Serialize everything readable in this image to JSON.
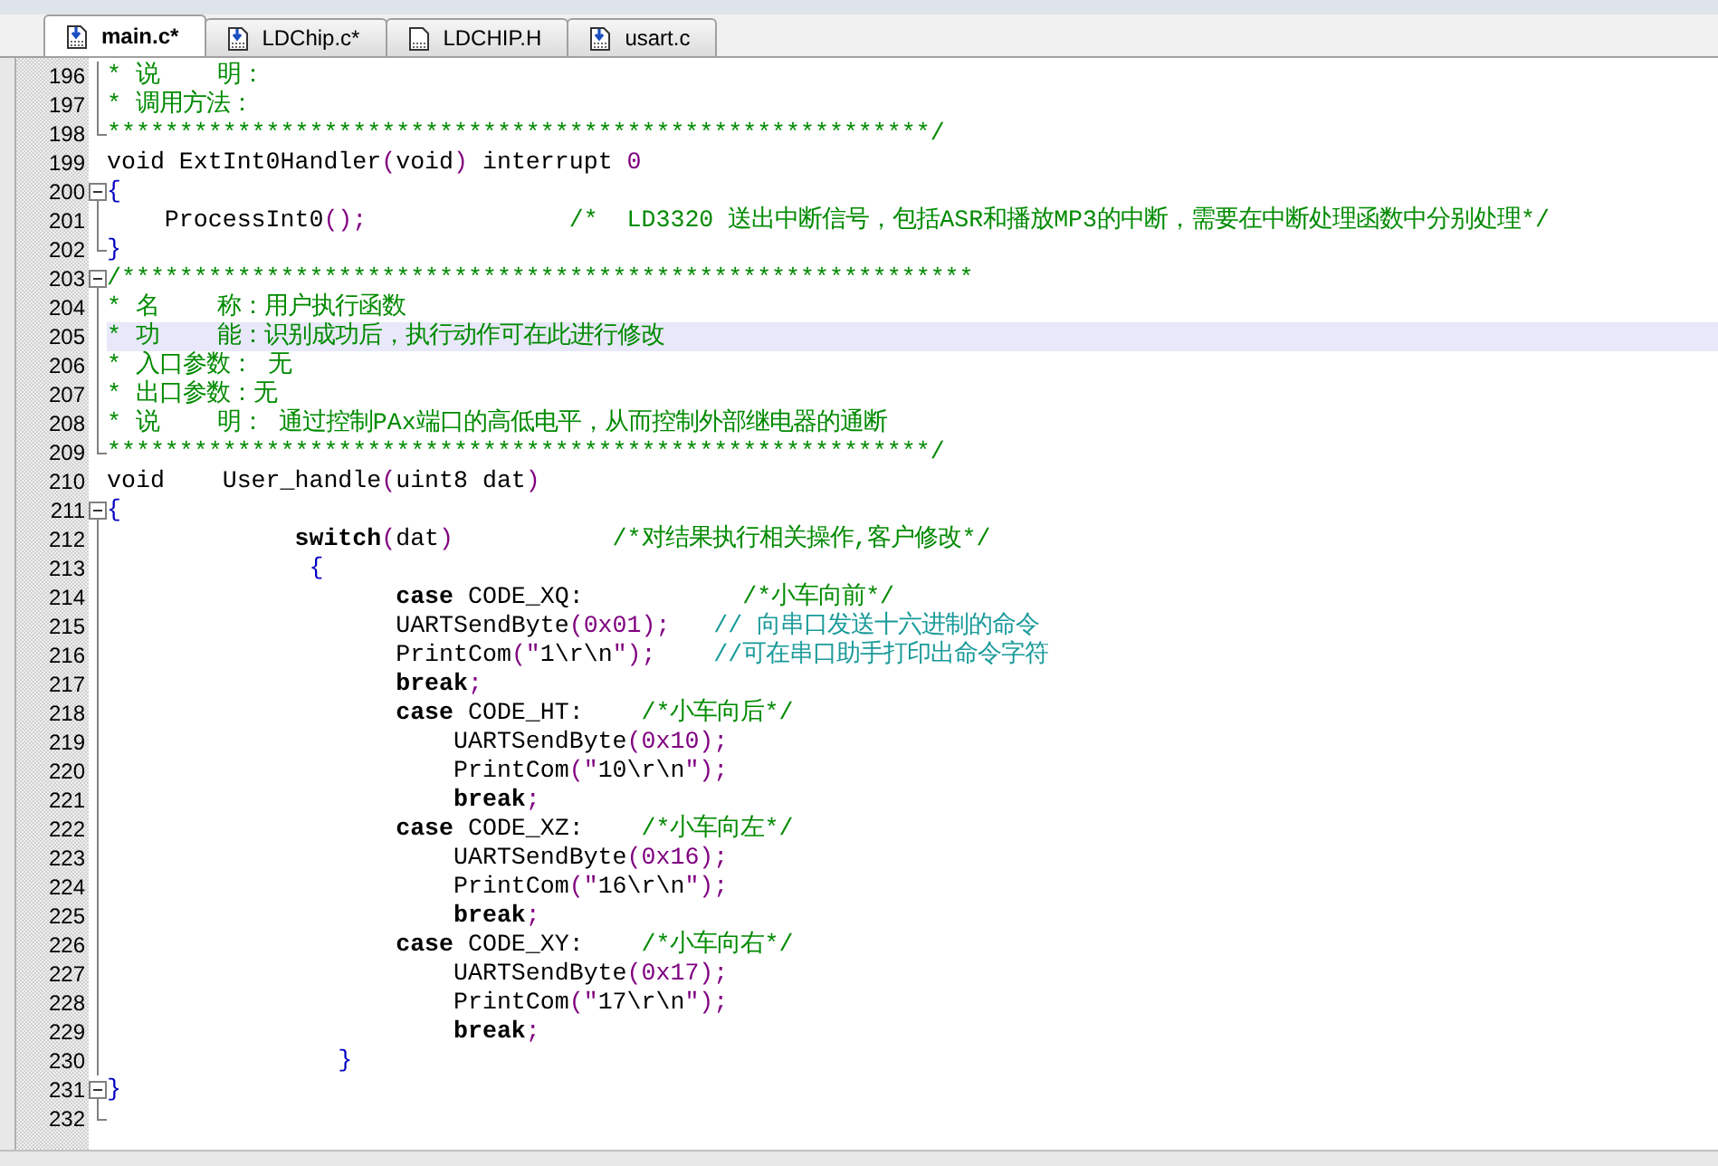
{
  "tabs": [
    {
      "label": "main.c*",
      "kind": "source",
      "selected": true
    },
    {
      "label": "LDChip.c*",
      "kind": "source",
      "selected": false
    },
    {
      "label": "LDCHIP.H",
      "kind": "header",
      "selected": false
    },
    {
      "label": "usart.c",
      "kind": "source",
      "selected": false
    }
  ],
  "lines": [
    {
      "number": "196",
      "kind": "line",
      "current": false,
      "tokens": [
        {
          "kind": "cmt",
          "t": "* 说    明："
        }
      ]
    },
    {
      "number": "197",
      "kind": "line",
      "current": false,
      "tokens": [
        {
          "kind": "cmt",
          "t": "* 调用方法："
        }
      ]
    },
    {
      "number": "198",
      "kind": "end",
      "current": false,
      "tokens": [
        {
          "kind": "cmt",
          "t": "*********************************************************/"
        }
      ]
    },
    {
      "number": "199",
      "kind": "plain",
      "current": false,
      "tokens": [
        {
          "kind": "plain",
          "t": "void ExtInt0Handler"
        },
        {
          "kind": "punc",
          "t": "("
        },
        {
          "kind": "plain",
          "t": "void"
        },
        {
          "kind": "punc",
          "t": ")"
        },
        {
          "kind": "plain",
          "t": " interrupt "
        },
        {
          "kind": "num",
          "t": "0"
        }
      ]
    },
    {
      "number": "200",
      "kind": "start",
      "current": false,
      "tokens": [
        {
          "kind": "brace",
          "t": "{"
        }
      ]
    },
    {
      "number": "201",
      "kind": "line",
      "current": false,
      "tokens": [
        {
          "kind": "plain",
          "t": "    ProcessInt0"
        },
        {
          "kind": "punc",
          "t": "();"
        },
        {
          "kind": "cmt",
          "t": "              /*  LD3320 送出中断信号，包括ASR和播放MP3的中断，需要在中断处理函数中分别处理*/"
        }
      ]
    },
    {
      "number": "202",
      "kind": "end",
      "current": false,
      "tokens": [
        {
          "kind": "brace",
          "t": "}"
        }
      ]
    },
    {
      "number": "203",
      "kind": "start",
      "current": false,
      "tokens": [
        {
          "kind": "cmt",
          "t": "/***********************************************************"
        }
      ]
    },
    {
      "number": "204",
      "kind": "line",
      "current": false,
      "tokens": [
        {
          "kind": "cmt",
          "t": "* 名    称：用户执行函数"
        }
      ]
    },
    {
      "number": "205",
      "kind": "line",
      "current": true,
      "tokens": [
        {
          "kind": "cmt",
          "t": "* 功    能：识别成功后，执行动作可在此进行修改"
        }
      ]
    },
    {
      "number": "206",
      "kind": "line",
      "current": false,
      "tokens": [
        {
          "kind": "cmt",
          "t": "* 入口参数： 无"
        }
      ]
    },
    {
      "number": "207",
      "kind": "line",
      "current": false,
      "tokens": [
        {
          "kind": "cmt",
          "t": "* 出口参数：无"
        }
      ]
    },
    {
      "number": "208",
      "kind": "line",
      "current": false,
      "tokens": [
        {
          "kind": "cmt",
          "t": "* 说    明： 通过控制PAx端口的高低电平，从而控制外部继电器的通断"
        }
      ]
    },
    {
      "number": "209",
      "kind": "end",
      "current": false,
      "tokens": [
        {
          "kind": "cmt",
          "t": "*********************************************************/"
        }
      ]
    },
    {
      "number": "210",
      "kind": "plain",
      "current": false,
      "tokens": [
        {
          "kind": "plain",
          "t": "void    User_handle"
        },
        {
          "kind": "punc",
          "t": "("
        },
        {
          "kind": "plain",
          "t": "uint8 dat"
        },
        {
          "kind": "punc",
          "t": ")"
        }
      ]
    },
    {
      "number": "211",
      "kind": "start",
      "current": false,
      "tokens": [
        {
          "kind": "brace",
          "t": "{"
        }
      ]
    },
    {
      "number": "212",
      "kind": "line",
      "current": false,
      "tokens": [
        {
          "kind": "kw",
          "t": "             switch"
        },
        {
          "kind": "punc",
          "t": "("
        },
        {
          "kind": "plain",
          "t": "dat"
        },
        {
          "kind": "punc",
          "t": ")"
        },
        {
          "kind": "cmt",
          "t": "           /*对结果执行相关操作,客户修改*/"
        }
      ]
    },
    {
      "number": "213",
      "kind": "line",
      "current": false,
      "tokens": [
        {
          "kind": "brace",
          "t": "              {"
        }
      ]
    },
    {
      "number": "214",
      "kind": "line",
      "current": false,
      "tokens": [
        {
          "kind": "kw",
          "t": "                    case"
        },
        {
          "kind": "plain",
          "t": " CODE_XQ:           "
        },
        {
          "kind": "cmt",
          "t": "/*小车向前*/"
        }
      ]
    },
    {
      "number": "215",
      "kind": "line",
      "current": false,
      "tokens": [
        {
          "kind": "plain",
          "t": "                    UARTSendByte"
        },
        {
          "kind": "punc",
          "t": "("
        },
        {
          "kind": "num",
          "t": "0x01"
        },
        {
          "kind": "punc",
          "t": ");"
        },
        {
          "kind": "lcmt",
          "t": "   // 向串口发送十六进制的命令"
        }
      ]
    },
    {
      "number": "216",
      "kind": "line",
      "current": false,
      "tokens": [
        {
          "kind": "plain",
          "t": "                    PrintCom"
        },
        {
          "kind": "punc",
          "t": "(\""
        },
        {
          "kind": "plain",
          "t": "1\\r\\n"
        },
        {
          "kind": "punc",
          "t": "\");"
        },
        {
          "kind": "lcmt",
          "t": "    //可在串口助手打印出命令字符"
        }
      ]
    },
    {
      "number": "217",
      "kind": "line",
      "current": false,
      "tokens": [
        {
          "kind": "kw",
          "t": "                    break"
        },
        {
          "kind": "punc",
          "t": ";"
        }
      ]
    },
    {
      "number": "218",
      "kind": "line",
      "current": false,
      "tokens": [
        {
          "kind": "kw",
          "t": "                    case"
        },
        {
          "kind": "plain",
          "t": " CODE_HT:    "
        },
        {
          "kind": "cmt",
          "t": "/*小车向后*/"
        }
      ]
    },
    {
      "number": "219",
      "kind": "line",
      "current": false,
      "tokens": [
        {
          "kind": "plain",
          "t": "                        UARTSendByte"
        },
        {
          "kind": "punc",
          "t": "("
        },
        {
          "kind": "num",
          "t": "0x10"
        },
        {
          "kind": "punc",
          "t": ");"
        }
      ]
    },
    {
      "number": "220",
      "kind": "line",
      "current": false,
      "tokens": [
        {
          "kind": "plain",
          "t": "                        PrintCom"
        },
        {
          "kind": "punc",
          "t": "(\""
        },
        {
          "kind": "plain",
          "t": "10\\r\\n"
        },
        {
          "kind": "punc",
          "t": "\");"
        }
      ]
    },
    {
      "number": "221",
      "kind": "line",
      "current": false,
      "tokens": [
        {
          "kind": "kw",
          "t": "                        break"
        },
        {
          "kind": "punc",
          "t": ";"
        }
      ]
    },
    {
      "number": "222",
      "kind": "line",
      "current": false,
      "tokens": [
        {
          "kind": "kw",
          "t": "                    case"
        },
        {
          "kind": "plain",
          "t": " CODE_XZ:    "
        },
        {
          "kind": "cmt",
          "t": "/*小车向左*/"
        }
      ]
    },
    {
      "number": "223",
      "kind": "line",
      "current": false,
      "tokens": [
        {
          "kind": "plain",
          "t": "                        UARTSendByte"
        },
        {
          "kind": "punc",
          "t": "("
        },
        {
          "kind": "num",
          "t": "0x16"
        },
        {
          "kind": "punc",
          "t": ");"
        }
      ]
    },
    {
      "number": "224",
      "kind": "line",
      "current": false,
      "tokens": [
        {
          "kind": "plain",
          "t": "                        PrintCom"
        },
        {
          "kind": "punc",
          "t": "(\""
        },
        {
          "kind": "plain",
          "t": "16\\r\\n"
        },
        {
          "kind": "punc",
          "t": "\");"
        }
      ]
    },
    {
      "number": "225",
      "kind": "line",
      "current": false,
      "tokens": [
        {
          "kind": "kw",
          "t": "                        break"
        },
        {
          "kind": "punc",
          "t": ";"
        }
      ]
    },
    {
      "number": "226",
      "kind": "line",
      "current": false,
      "tokens": [
        {
          "kind": "kw",
          "t": "                    case"
        },
        {
          "kind": "plain",
          "t": " CODE_XY:    "
        },
        {
          "kind": "cmt",
          "t": "/*小车向右*/"
        }
      ]
    },
    {
      "number": "227",
      "kind": "line",
      "current": false,
      "tokens": [
        {
          "kind": "plain",
          "t": "                        UARTSendByte"
        },
        {
          "kind": "punc",
          "t": "("
        },
        {
          "kind": "num",
          "t": "0x17"
        },
        {
          "kind": "punc",
          "t": ");"
        }
      ]
    },
    {
      "number": "228",
      "kind": "line",
      "current": false,
      "tokens": [
        {
          "kind": "plain",
          "t": "                        PrintCom"
        },
        {
          "kind": "punc",
          "t": "(\""
        },
        {
          "kind": "plain",
          "t": "17\\r\\n"
        },
        {
          "kind": "punc",
          "t": "\");"
        }
      ]
    },
    {
      "number": "229",
      "kind": "line",
      "current": false,
      "tokens": [
        {
          "kind": "kw",
          "t": "                        break"
        },
        {
          "kind": "punc",
          "t": ";"
        }
      ]
    },
    {
      "number": "230",
      "kind": "line",
      "current": false,
      "tokens": [
        {
          "kind": "brace",
          "t": "                }"
        }
      ]
    },
    {
      "number": "231",
      "kind": "start",
      "current": false,
      "tokens": [
        {
          "kind": "brace",
          "t": "}"
        }
      ]
    },
    {
      "number": "232",
      "kind": "end",
      "current": false
    }
  ]
}
